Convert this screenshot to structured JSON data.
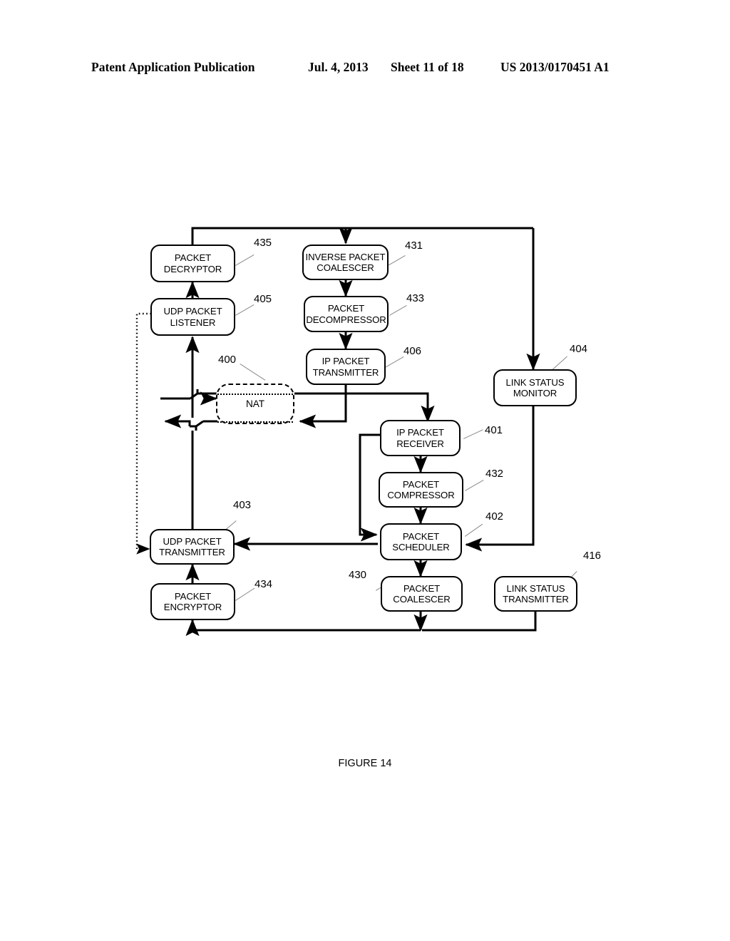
{
  "header": {
    "publication": "Patent Application Publication",
    "date": "Jul. 4, 2013",
    "sheet": "Sheet 11 of 18",
    "number": "US 2013/0170451 A1"
  },
  "figure": {
    "caption": "FIGURE 14",
    "nodes": [
      {
        "id": "packet-decryptor",
        "line1": "PACKET",
        "line2": "DECRYPTOR",
        "ref": "435"
      },
      {
        "id": "udp-packet-listener",
        "line1": "UDP PACKET",
        "line2": "LISTENER",
        "ref": "405"
      },
      {
        "id": "inverse-packet-coalescer",
        "line1": "INVERSE PACKET",
        "line2": "COALESCER",
        "ref": "431"
      },
      {
        "id": "packet-decompressor",
        "line1": "PACKET",
        "line2": "DECOMPRESSOR",
        "ref": "433"
      },
      {
        "id": "ip-packet-transmitter",
        "line1": "IP PACKET",
        "line2": "TRANSMITTER",
        "ref": "406"
      },
      {
        "id": "link-status-monitor",
        "line1": "LINK STATUS",
        "line2": "MONITOR",
        "ref": "404"
      },
      {
        "id": "nat",
        "line1": "NAT",
        "line2": "",
        "ref": "400"
      },
      {
        "id": "ip-packet-receiver",
        "line1": "IP PACKET",
        "line2": "RECEIVER",
        "ref": "401"
      },
      {
        "id": "packet-compressor",
        "line1": "PACKET",
        "line2": "COMPRESSOR",
        "ref": "432"
      },
      {
        "id": "packet-scheduler",
        "line1": "PACKET",
        "line2": "SCHEDULER",
        "ref": "402"
      },
      {
        "id": "udp-packet-transmitter",
        "line1": "UDP PACKET",
        "line2": "TRANSMITTER",
        "ref": "403"
      },
      {
        "id": "packet-encryptor",
        "line1": "PACKET",
        "line2": "ENCRYPTOR",
        "ref": "434"
      },
      {
        "id": "packet-coalescer",
        "line1": "PACKET",
        "line2": "COALESCER",
        "ref": "430"
      },
      {
        "id": "link-status-transmitter",
        "line1": "LINK STATUS",
        "line2": "TRANSMITTER",
        "ref": "416"
      }
    ]
  }
}
